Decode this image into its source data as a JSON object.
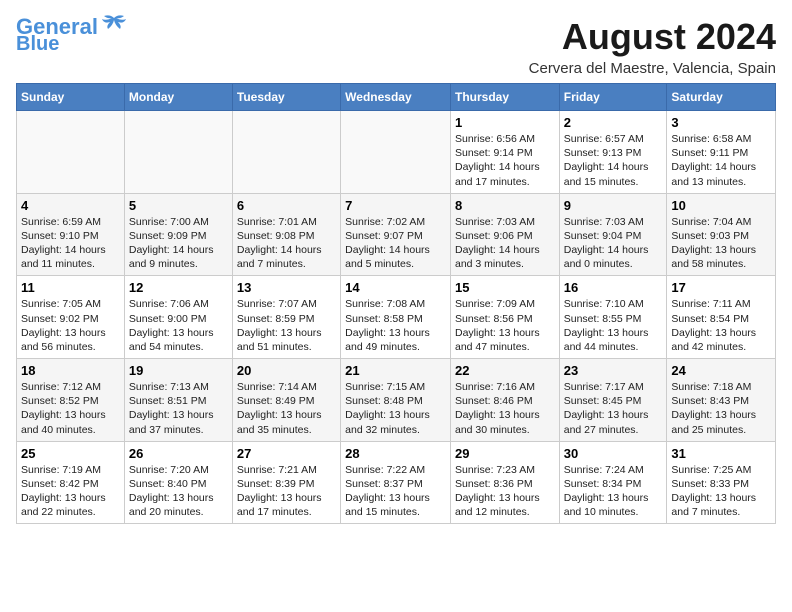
{
  "header": {
    "logo_line1": "General",
    "logo_line2": "Blue",
    "main_title": "August 2024",
    "subtitle": "Cervera del Maestre, Valencia, Spain"
  },
  "days_of_week": [
    "Sunday",
    "Monday",
    "Tuesday",
    "Wednesday",
    "Thursday",
    "Friday",
    "Saturday"
  ],
  "weeks": [
    [
      {
        "day": "",
        "info": ""
      },
      {
        "day": "",
        "info": ""
      },
      {
        "day": "",
        "info": ""
      },
      {
        "day": "",
        "info": ""
      },
      {
        "day": "1",
        "info": "Sunrise: 6:56 AM\nSunset: 9:14 PM\nDaylight: 14 hours\nand 17 minutes."
      },
      {
        "day": "2",
        "info": "Sunrise: 6:57 AM\nSunset: 9:13 PM\nDaylight: 14 hours\nand 15 minutes."
      },
      {
        "day": "3",
        "info": "Sunrise: 6:58 AM\nSunset: 9:11 PM\nDaylight: 14 hours\nand 13 minutes."
      }
    ],
    [
      {
        "day": "4",
        "info": "Sunrise: 6:59 AM\nSunset: 9:10 PM\nDaylight: 14 hours\nand 11 minutes."
      },
      {
        "day": "5",
        "info": "Sunrise: 7:00 AM\nSunset: 9:09 PM\nDaylight: 14 hours\nand 9 minutes."
      },
      {
        "day": "6",
        "info": "Sunrise: 7:01 AM\nSunset: 9:08 PM\nDaylight: 14 hours\nand 7 minutes."
      },
      {
        "day": "7",
        "info": "Sunrise: 7:02 AM\nSunset: 9:07 PM\nDaylight: 14 hours\nand 5 minutes."
      },
      {
        "day": "8",
        "info": "Sunrise: 7:03 AM\nSunset: 9:06 PM\nDaylight: 14 hours\nand 3 minutes."
      },
      {
        "day": "9",
        "info": "Sunrise: 7:03 AM\nSunset: 9:04 PM\nDaylight: 14 hours\nand 0 minutes."
      },
      {
        "day": "10",
        "info": "Sunrise: 7:04 AM\nSunset: 9:03 PM\nDaylight: 13 hours\nand 58 minutes."
      }
    ],
    [
      {
        "day": "11",
        "info": "Sunrise: 7:05 AM\nSunset: 9:02 PM\nDaylight: 13 hours\nand 56 minutes."
      },
      {
        "day": "12",
        "info": "Sunrise: 7:06 AM\nSunset: 9:00 PM\nDaylight: 13 hours\nand 54 minutes."
      },
      {
        "day": "13",
        "info": "Sunrise: 7:07 AM\nSunset: 8:59 PM\nDaylight: 13 hours\nand 51 minutes."
      },
      {
        "day": "14",
        "info": "Sunrise: 7:08 AM\nSunset: 8:58 PM\nDaylight: 13 hours\nand 49 minutes."
      },
      {
        "day": "15",
        "info": "Sunrise: 7:09 AM\nSunset: 8:56 PM\nDaylight: 13 hours\nand 47 minutes."
      },
      {
        "day": "16",
        "info": "Sunrise: 7:10 AM\nSunset: 8:55 PM\nDaylight: 13 hours\nand 44 minutes."
      },
      {
        "day": "17",
        "info": "Sunrise: 7:11 AM\nSunset: 8:54 PM\nDaylight: 13 hours\nand 42 minutes."
      }
    ],
    [
      {
        "day": "18",
        "info": "Sunrise: 7:12 AM\nSunset: 8:52 PM\nDaylight: 13 hours\nand 40 minutes."
      },
      {
        "day": "19",
        "info": "Sunrise: 7:13 AM\nSunset: 8:51 PM\nDaylight: 13 hours\nand 37 minutes."
      },
      {
        "day": "20",
        "info": "Sunrise: 7:14 AM\nSunset: 8:49 PM\nDaylight: 13 hours\nand 35 minutes."
      },
      {
        "day": "21",
        "info": "Sunrise: 7:15 AM\nSunset: 8:48 PM\nDaylight: 13 hours\nand 32 minutes."
      },
      {
        "day": "22",
        "info": "Sunrise: 7:16 AM\nSunset: 8:46 PM\nDaylight: 13 hours\nand 30 minutes."
      },
      {
        "day": "23",
        "info": "Sunrise: 7:17 AM\nSunset: 8:45 PM\nDaylight: 13 hours\nand 27 minutes."
      },
      {
        "day": "24",
        "info": "Sunrise: 7:18 AM\nSunset: 8:43 PM\nDaylight: 13 hours\nand 25 minutes."
      }
    ],
    [
      {
        "day": "25",
        "info": "Sunrise: 7:19 AM\nSunset: 8:42 PM\nDaylight: 13 hours\nand 22 minutes."
      },
      {
        "day": "26",
        "info": "Sunrise: 7:20 AM\nSunset: 8:40 PM\nDaylight: 13 hours\nand 20 minutes."
      },
      {
        "day": "27",
        "info": "Sunrise: 7:21 AM\nSunset: 8:39 PM\nDaylight: 13 hours\nand 17 minutes."
      },
      {
        "day": "28",
        "info": "Sunrise: 7:22 AM\nSunset: 8:37 PM\nDaylight: 13 hours\nand 15 minutes."
      },
      {
        "day": "29",
        "info": "Sunrise: 7:23 AM\nSunset: 8:36 PM\nDaylight: 13 hours\nand 12 minutes."
      },
      {
        "day": "30",
        "info": "Sunrise: 7:24 AM\nSunset: 8:34 PM\nDaylight: 13 hours\nand 10 minutes."
      },
      {
        "day": "31",
        "info": "Sunrise: 7:25 AM\nSunset: 8:33 PM\nDaylight: 13 hours\nand 7 minutes."
      }
    ]
  ]
}
